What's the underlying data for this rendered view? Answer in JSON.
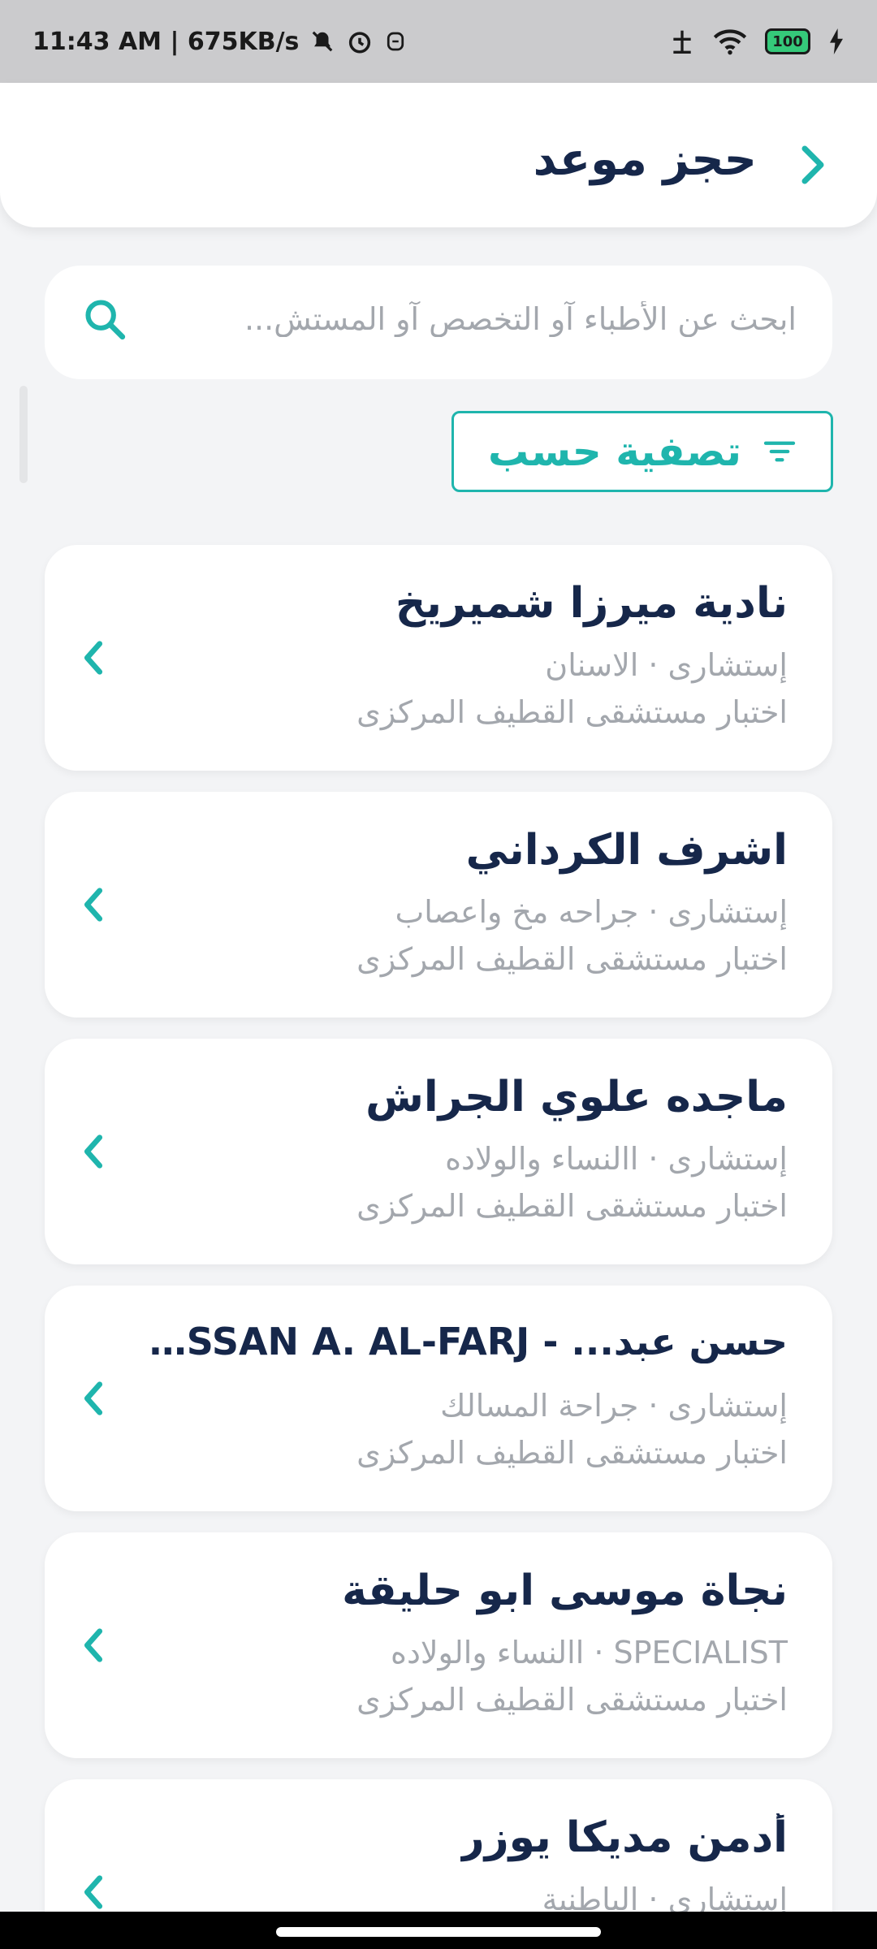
{
  "status_bar": {
    "time_speed": "11:43 AM | 675KB/s",
    "battery": "100"
  },
  "header": {
    "title": "حجز موعد"
  },
  "search": {
    "placeholder": "ابحث عن الأطباء آو التخصص آو المستش..."
  },
  "filter": {
    "label": "تصفية حسب"
  },
  "doctors": [
    {
      "name": "نادية ميرزا شميريخ",
      "specialty": "إستشارى · الاسنان",
      "hospital": "اختبار مستشقى القطيف المركزى"
    },
    {
      "name": "اشرف الكرداني",
      "specialty": "إستشارى · جراحه مخ واعصاب",
      "hospital": "اختبار مستشقى القطيف المركزى"
    },
    {
      "name": "ماجده علوي الجراش",
      "specialty": "إستشارى · االنساء والولاده",
      "hospital": "اختبار مستشقى القطيف المركزى"
    },
    {
      "name": "حسن عبد... - HASSAN A. AL-FARJ",
      "specialty": "إستشارى · جراحة المسالك",
      "hospital": "اختبار مستشقى القطيف المركزى"
    },
    {
      "name": "نجاة موسى ابو حليقة",
      "specialty": "SPECIALIST · االنساء والولاده",
      "hospital": "اختبار مستشقى القطيف المركزى"
    },
    {
      "name": "أدمن مديكا يوزر",
      "specialty": "إستشارى · الباطنية",
      "hospital": ""
    }
  ],
  "colors": {
    "accent": "#1fb5ad",
    "title": "#16274a",
    "muted": "#a3a7ad",
    "background": "#f3f4f6"
  },
  "icons": {
    "back": "chevron-right-icon",
    "search": "search-icon",
    "filter": "filter-icon",
    "row": "chevron-left-icon"
  }
}
